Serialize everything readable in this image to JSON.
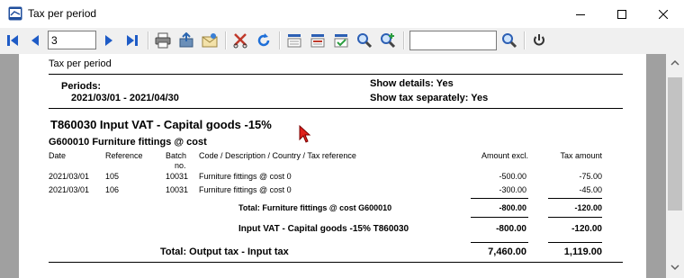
{
  "window": {
    "title": "Tax per period"
  },
  "toolbar": {
    "page_value": "3",
    "search_value": ""
  },
  "report": {
    "heading": "Tax per period",
    "periods_label": "Periods:",
    "periods_value": "2021/03/01  -   2021/04/30",
    "show_details": "Show details: Yes",
    "show_tax_separately": "Show tax separately: Yes",
    "tax_code_title": "T860030  Input VAT - Capital goods -15%",
    "account_title": "G600010   Furniture  fittings @ cost",
    "columns": {
      "date": "Date",
      "reference": "Reference",
      "batch_no_1": "Batch",
      "batch_no_2": "no.",
      "code_desc": "Code / Description / Country / Tax reference",
      "amount_excl": "Amount excl.",
      "tax_amount": "Tax amount"
    },
    "rows": [
      {
        "date": "2021/03/01",
        "reference": "105",
        "batch": "10031",
        "description": "Furniture  fittings @ cost 0",
        "amount_excl": "-500.00",
        "tax_amount": "-75.00"
      },
      {
        "date": "2021/03/01",
        "reference": "106",
        "batch": "10031",
        "description": "Furniture  fittings @ cost 0",
        "amount_excl": "-300.00",
        "tax_amount": "-45.00"
      }
    ],
    "account_total": {
      "label": "Total: Furniture  fittings @ cost    G600010",
      "amount_excl": "-800.00",
      "tax_amount": "-120.00"
    },
    "tax_code_total": {
      "label": "Input VAT - Capital goods -15%    T860030",
      "amount_excl": "-800.00",
      "tax_amount": "-120.00"
    },
    "grand_total": {
      "label": "Total:  Output tax - Input tax",
      "amount_excl": "7,460.00",
      "tax_amount": "1,119.00"
    }
  }
}
